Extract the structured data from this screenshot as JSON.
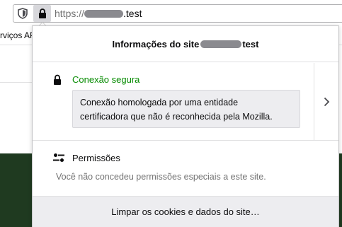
{
  "browser": {
    "url_scheme": "https://",
    "url_suffix": ".test",
    "bookmark_label": "rviços AP"
  },
  "panel": {
    "title_prefix": "Informações do site",
    "title_suffix": "test",
    "security": {
      "label": "Conexão segura",
      "note_line1": "Conexão homologada por uma entidade",
      "note_line2": "certificadora que não é reconhecida pela Mozilla.",
      "expand_icon": "chevron-right-icon"
    },
    "permissions": {
      "title": "Permissões",
      "empty_text": "Você não concedeu permissões especiais a este site."
    },
    "clear_button_label": "Limpar os cookies e dados do site…"
  },
  "colors": {
    "secure_green": "#058b00",
    "page_green": "#1f3a20",
    "footer_bg": "#ededf0"
  }
}
